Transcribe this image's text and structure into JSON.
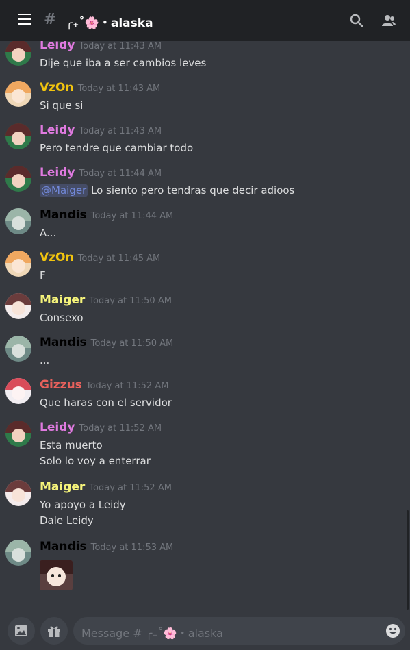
{
  "header": {
    "menu_icon": "hamburger-menu-icon",
    "hash": "#",
    "channel_name": "╭₊˚🌸・alaska",
    "search_icon": "search-icon",
    "members_icon": "members-icon"
  },
  "messages": [
    {
      "author": "Leidy",
      "color": "#e07ae0",
      "time": "Today at 11:43 AM",
      "lines": [
        "Dije que iba a ser cambios leves"
      ]
    },
    {
      "author": "VzOn",
      "color": "#f1c40f",
      "time": "Today at 11:43 AM",
      "lines": [
        "Si que si"
      ]
    },
    {
      "author": "Leidy",
      "color": "#e07ae0",
      "time": "Today at 11:43 AM",
      "lines": [
        "Pero tendre que cambiar todo"
      ]
    },
    {
      "author": "Leidy",
      "color": "#e07ae0",
      "time": "Today at 11:44 AM",
      "mention": "@Maiger",
      "lines": [
        "Lo siento pero tendras que decir adioos"
      ]
    },
    {
      "author": "Mandis",
      "color": "#000000",
      "time": "Today at 11:44 AM",
      "lines": [
        "A..."
      ]
    },
    {
      "author": "VzOn",
      "color": "#f1c40f",
      "time": "Today at 11:45 AM",
      "lines": [
        "F"
      ]
    },
    {
      "author": "Maiger",
      "color": "#f5f37a",
      "time": "Today at 11:50 AM",
      "lines": [
        "Consexo"
      ]
    },
    {
      "author": "Mandis",
      "color": "#000000",
      "time": "Today at 11:50 AM",
      "lines": [
        "..."
      ]
    },
    {
      "author": "Gizzus",
      "color": "#e8615c",
      "time": "Today at 11:52 AM",
      "lines": [
        "Que haras con el servidor"
      ]
    },
    {
      "author": "Leidy",
      "color": "#e07ae0",
      "time": "Today at 11:52 AM",
      "lines": [
        "Esta muerto",
        "Solo lo voy a enterrar"
      ]
    },
    {
      "author": "Maiger",
      "color": "#f5f37a",
      "time": "Today at 11:52 AM",
      "lines": [
        "Yo apoyo a Leidy",
        "Dale Leidy"
      ]
    },
    {
      "author": "Mandis",
      "color": "#000000",
      "time": "Today at 11:53 AM",
      "lines": []
    }
  ],
  "composer": {
    "image_icon": "image-upload-icon",
    "gift_icon": "gift-icon",
    "placeholder": "Message # ╭₊˚🌸・alaska",
    "emoji_icon": "emoji-icon"
  },
  "colors": {
    "background": "#36393f",
    "header_bg": "#202225",
    "input_bg": "#40444b",
    "timestamp": "#72767d",
    "text": "#dcddde",
    "mention": "#7289da"
  }
}
